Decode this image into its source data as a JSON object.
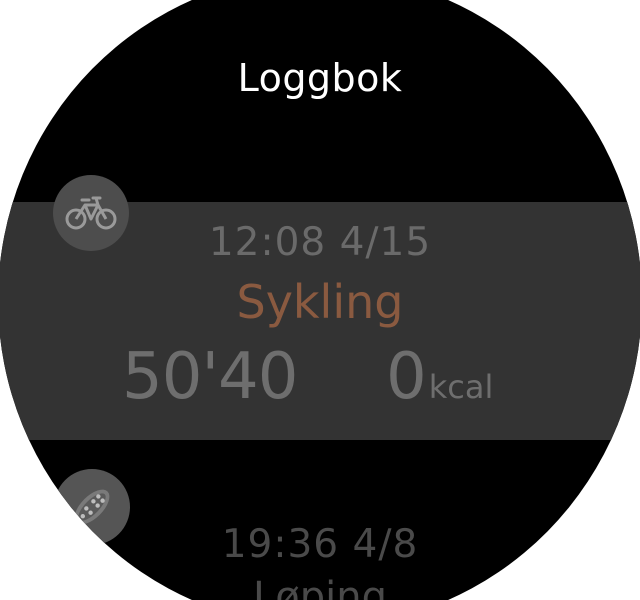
{
  "header": {
    "title": "Loggbok"
  },
  "entries": [
    {
      "time": "12:08",
      "date": "4/15",
      "time_date": "12:08  4/15",
      "sport": "Sykling",
      "icon": "bike-icon",
      "duration": "50'40",
      "calories": "0",
      "calories_unit": "kcal",
      "selected": true
    },
    {
      "time": "19:36",
      "date": "4/8",
      "time_date": "19:36  4/8",
      "sport": "Løping",
      "icon": "running-shoe-icon",
      "selected": false
    }
  ],
  "colors": {
    "background": "#000000",
    "selected_row": "#333333",
    "sport_accent": "#8a5a40",
    "title": "#ffffff"
  }
}
